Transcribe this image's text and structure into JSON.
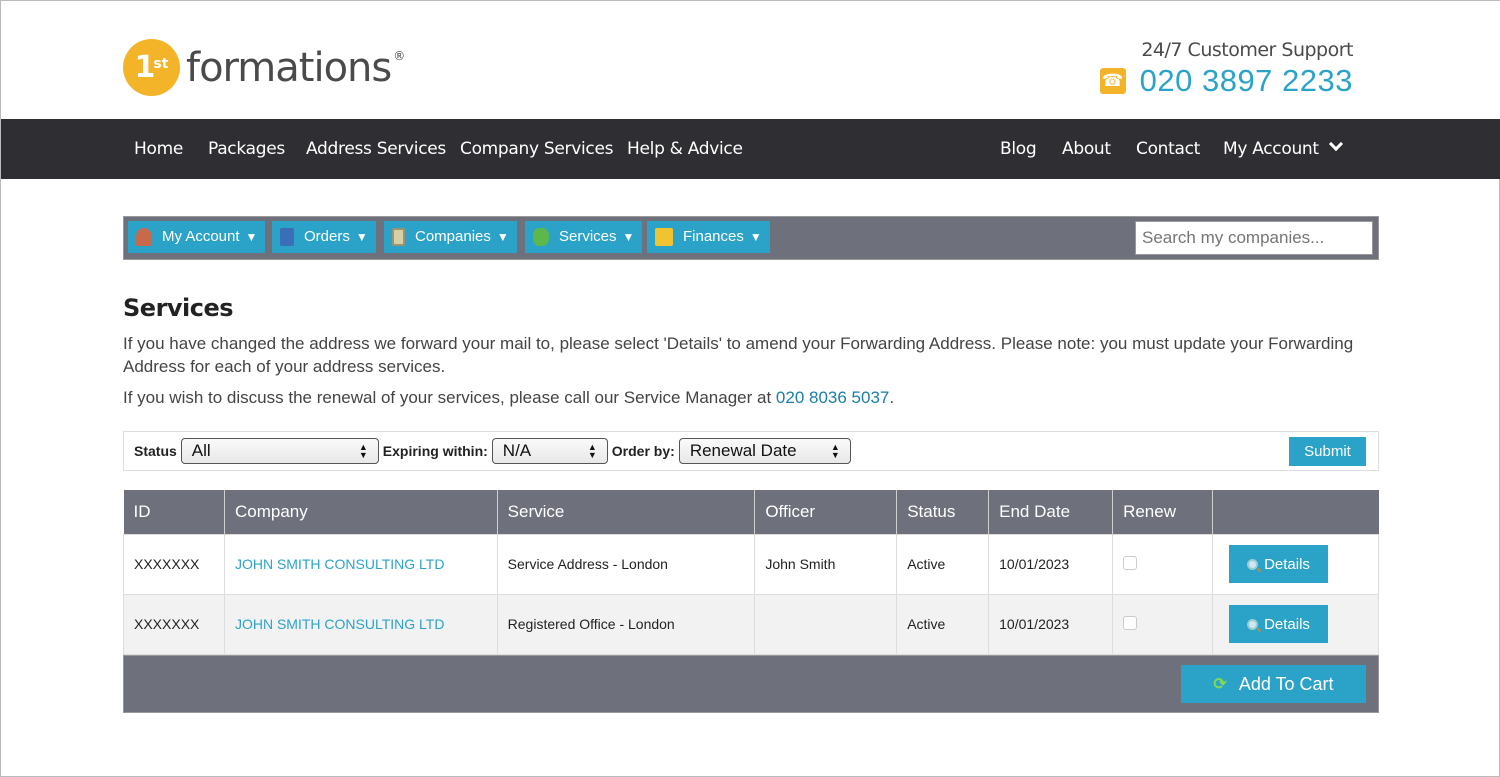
{
  "header": {
    "logo_badge": "1",
    "logo_badge_sup": "st",
    "logo_word": "formations",
    "logo_reg": "®",
    "support_label": "24/7 Customer Support",
    "support_phone": "020 3897 2233",
    "phone_icon": "☎"
  },
  "mainnav": {
    "left": [
      "Home",
      "Packages",
      "Address Services",
      "Company Services",
      "Help & Advice"
    ],
    "right": [
      "Blog",
      "About",
      "Contact",
      "My Account"
    ]
  },
  "toolbar": {
    "items": [
      {
        "label": "My Account",
        "icon": "user-icon",
        "color": "#c86a4a"
      },
      {
        "label": "Orders",
        "icon": "calculator-icon",
        "color": "#3a6fb8"
      },
      {
        "label": "Companies",
        "icon": "building-icon",
        "color": "#d6d0a8"
      },
      {
        "label": "Services",
        "icon": "puzzle-icon",
        "color": "#5cb84a"
      },
      {
        "label": "Finances",
        "icon": "coins-icon",
        "color": "#f0c430"
      }
    ],
    "arrow": "▼",
    "search_placeholder": "Search my companies..."
  },
  "content": {
    "title": "Services",
    "intro": "If you have changed the address we forward your mail to, please select 'Details' to amend your Forwarding Address. Please note: you must update your Forwarding Address for each of your address services.",
    "renewal_prefix": "If you wish to discuss the renewal of your services, please call our Service Manager at ",
    "renewal_phone": "020 8036 5037",
    "renewal_suffix": "."
  },
  "filters": {
    "status_label": "Status",
    "status_value": "All",
    "expiring_label": "Expiring within:",
    "expiring_value": "N/A",
    "order_label": "Order by:",
    "order_value": "Renewal Date",
    "submit": "Submit"
  },
  "table": {
    "columns": [
      "ID",
      "Company",
      "Service",
      "Officer",
      "Status",
      "End Date",
      "Renew",
      ""
    ],
    "rows": [
      {
        "id": "XXXXXXX",
        "company": "JOHN SMITH CONSULTING LTD",
        "service": "Service Address - London",
        "officer": "John Smith",
        "status": "Active",
        "end_date": "10/01/2023",
        "renew": false,
        "action": "Details"
      },
      {
        "id": "XXXXXXX",
        "company": "JOHN SMITH CONSULTING LTD",
        "service": "Registered Office - London",
        "officer": "",
        "status": "Active",
        "end_date": "10/01/2023",
        "renew": false,
        "action": "Details"
      }
    ],
    "add_to_cart": "Add To Cart"
  },
  "colors": {
    "brand_yellow": "#f4b42a",
    "accent_blue": "#2ba3c9",
    "nav_dark": "#2f2f33",
    "toolbar_gray": "#6e707b"
  }
}
